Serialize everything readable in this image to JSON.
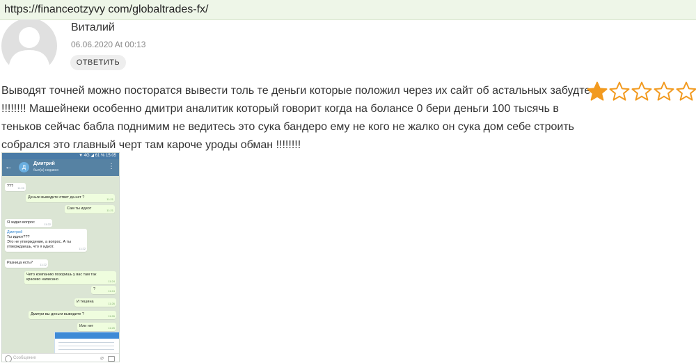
{
  "browser": {
    "url": "https://financeotzyvy com/globaltrades-fx/"
  },
  "comment": {
    "author": "Виталий",
    "date": "06.06.2020 At 00:13",
    "reply_label": "ОТВЕТИТЬ",
    "text_line1": "Выводят точней можно посторатся вывести толь те деньги которые положил через их сайт об астальных забудте",
    "text_rest": "!!!!!!!! Машейнеки особенно дмитри аналитик который говорит когда на болансе 0 бери деньги 100 тысячь в теньков сейчас бабла поднимим не ведитесь это сука бандеро ему не кого не жалко он сука дом себе строить собрался это главный черт там кароче уроды обман !!!!!!!!",
    "rating": {
      "value": 1,
      "max": 5,
      "filled_color": "#f29a1f",
      "empty_color": "#f29a1f"
    }
  },
  "attachment": {
    "status_bar": "▼ 4G ◢ 61 % 15:05",
    "contact_name": "Дмитрий",
    "contact_status": "был(а) недавно",
    "avatar_letter": "Д",
    "messages": [
      {
        "dir": "in",
        "text": "???",
        "time": "11:20"
      },
      {
        "dir": "out",
        "text": "Деньги выводите ответ да.нет ?",
        "time": "11:21"
      },
      {
        "dir": "out",
        "text": "Сам ты идиот",
        "time": "11:21"
      },
      {
        "dir": "in",
        "text": "Я задал вопрос",
        "time": "11:22"
      },
      {
        "dir": "in",
        "reply_to": "Дмитрий",
        "quote": "Ты идиот???",
        "text": "Это не утверждение, а вопрос. А ты утверждаешь, что я идиот.",
        "time": "11:22"
      },
      {
        "dir": "in",
        "text": "Разница есть?",
        "time": "11:22"
      },
      {
        "dir": "out",
        "text": "Чето компанию позоришь у вас там так красиво написано",
        "time": "11:24"
      },
      {
        "dir": "out",
        "text": "?",
        "time": "11:24"
      },
      {
        "dir": "out",
        "text": "И тешина",
        "time": "11:26"
      },
      {
        "dir": "out",
        "text": "Дмитри вы деньги выводите ?",
        "time": "11:26"
      },
      {
        "dir": "out",
        "text": "Или нет",
        "time": "11:26"
      }
    ],
    "input_placeholder": "Сообщение"
  }
}
